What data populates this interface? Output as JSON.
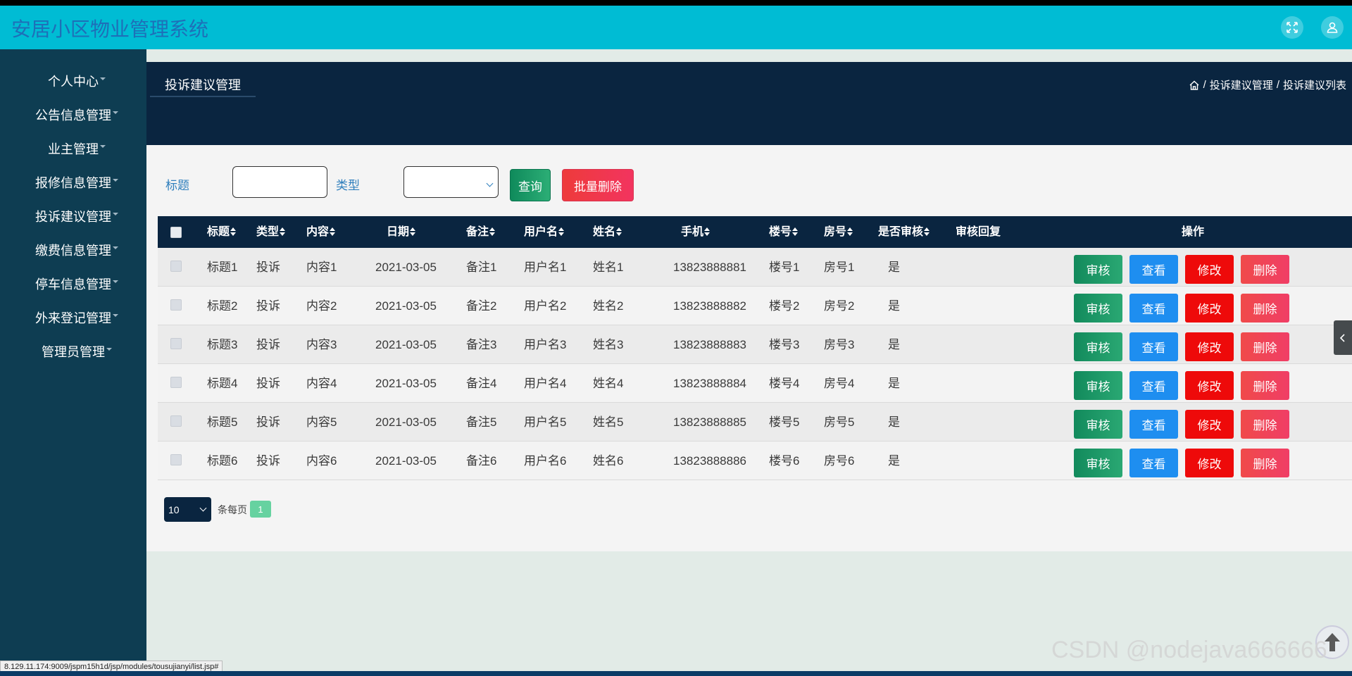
{
  "app": {
    "title": "安居小区物业管理系统"
  },
  "header": {
    "icons": [
      "fullscreen-icon",
      "user-icon"
    ]
  },
  "sidebar": {
    "items": [
      {
        "label": "个人中心"
      },
      {
        "label": "公告信息管理"
      },
      {
        "label": "业主管理"
      },
      {
        "label": "报修信息管理"
      },
      {
        "label": "投诉建议管理"
      },
      {
        "label": "缴费信息管理"
      },
      {
        "label": "停车信息管理"
      },
      {
        "label": "外来登记管理"
      },
      {
        "label": "管理员管理"
      }
    ]
  },
  "page": {
    "tab_title": "投诉建议管理",
    "breadcrumb": {
      "sep": "/",
      "items": [
        "投诉建议管理",
        "投诉建议列表"
      ]
    }
  },
  "search": {
    "title_label": "标题",
    "title_value": "",
    "type_label": "类型",
    "type_value": "",
    "query_button": "查询",
    "batch_delete_button": "批量删除"
  },
  "table": {
    "columns": [
      "标题",
      "类型",
      "内容",
      "日期",
      "备注",
      "用户名",
      "姓名",
      "手机",
      "楼号",
      "房号",
      "是否审核",
      "审核回复",
      "操作"
    ],
    "actions": [
      "审核",
      "查看",
      "修改",
      "删除"
    ],
    "rows": [
      [
        "标题1",
        "投诉",
        "内容1",
        "2021-03-05",
        "备注1",
        "用户名1",
        "姓名1",
        "13823888881",
        "楼号1",
        "房号1",
        "是",
        ""
      ],
      [
        "标题2",
        "投诉",
        "内容2",
        "2021-03-05",
        "备注2",
        "用户名2",
        "姓名2",
        "13823888882",
        "楼号2",
        "房号2",
        "是",
        ""
      ],
      [
        "标题3",
        "投诉",
        "内容3",
        "2021-03-05",
        "备注3",
        "用户名3",
        "姓名3",
        "13823888883",
        "楼号3",
        "房号3",
        "是",
        ""
      ],
      [
        "标题4",
        "投诉",
        "内容4",
        "2021-03-05",
        "备注4",
        "用户名4",
        "姓名4",
        "13823888884",
        "楼号4",
        "房号4",
        "是",
        ""
      ],
      [
        "标题5",
        "投诉",
        "内容5",
        "2021-03-05",
        "备注5",
        "用户名5",
        "姓名5",
        "13823888885",
        "楼号5",
        "房号5",
        "是",
        ""
      ],
      [
        "标题6",
        "投诉",
        "内容6",
        "2021-03-05",
        "备注6",
        "用户名6",
        "姓名6",
        "13823888886",
        "楼号6",
        "房号6",
        "是",
        ""
      ]
    ]
  },
  "pagination": {
    "page_size": "10",
    "per_page_label": "条每页",
    "current_page": "1"
  },
  "status_url": "8.129.11.174:9009/jspm15h1d/jsp/modules/tousujianyi/list.jsp#",
  "watermark": "CSDN @nodejava666666",
  "colors": {
    "topbar": "#00bcd4",
    "sidebar": "#0e3d52",
    "header_dark": "#0a2540",
    "green": "#128a5c",
    "blue": "#1e8ef0",
    "red": "#ee0a0a"
  }
}
